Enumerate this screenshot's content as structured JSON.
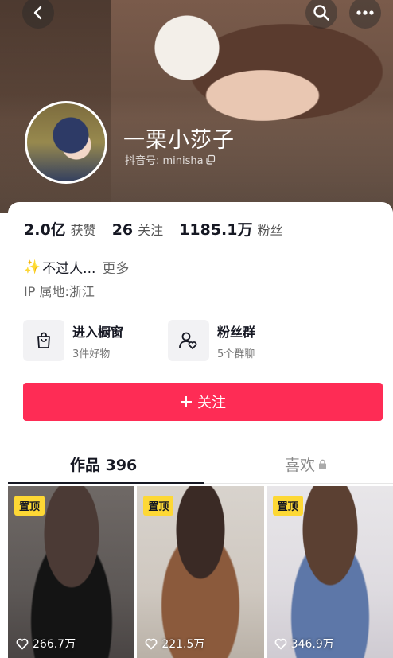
{
  "profile": {
    "name": "一栗小莎子",
    "douyin_id_label": "抖音号: minisha"
  },
  "stats": [
    {
      "value": "2.0亿",
      "label": "获赞"
    },
    {
      "value": "26",
      "label": "关注"
    },
    {
      "value": "1185.1万",
      "label": "粉丝"
    }
  ],
  "bio": {
    "text": "不过人...",
    "more": "更多",
    "ip": "IP 属地:浙江"
  },
  "features": [
    {
      "title": "进入橱窗",
      "sub": "3件好物",
      "icon": "shopping-bag-icon"
    },
    {
      "title": "粉丝群",
      "sub": "5个群聊",
      "icon": "fan-group-icon"
    }
  ],
  "follow_button": {
    "label": "关注"
  },
  "tabs": {
    "works": "作品 396",
    "liked": "喜欢"
  },
  "videos": [
    {
      "pin": "置顶",
      "likes": "266.7万"
    },
    {
      "pin": "置顶",
      "likes": "221.5万"
    },
    {
      "pin": "置顶",
      "likes": "346.9万"
    }
  ],
  "colors": {
    "accent": "#fe2c55",
    "pin_badge": "#fdd835"
  }
}
